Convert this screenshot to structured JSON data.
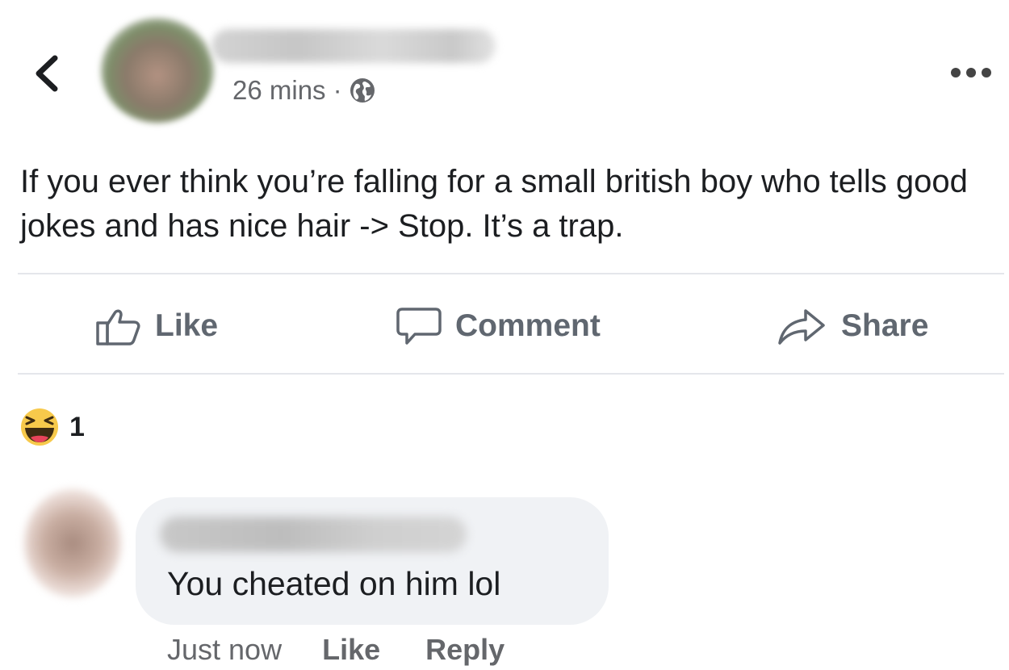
{
  "post": {
    "timestamp": "26 mins",
    "separator": "·",
    "privacy_icon": "globe-icon",
    "text": "If you ever think you’re falling for a small british boy who tells good jokes and has nice hair -> Stop. It’s a trap."
  },
  "actions": {
    "like_label": "Like",
    "comment_label": "Comment",
    "share_label": "Share"
  },
  "reactions": {
    "icon": "haha-icon",
    "count": "1"
  },
  "comment": {
    "text": "You cheated on him lol",
    "time": "Just now",
    "like_label": "Like",
    "reply_label": "Reply"
  },
  "colors": {
    "muted_text": "#65676b",
    "action_text": "#606770",
    "bubble_bg": "#f0f2f5",
    "divider": "#e4e6eb",
    "haha_yellow": "#f7c94b"
  }
}
